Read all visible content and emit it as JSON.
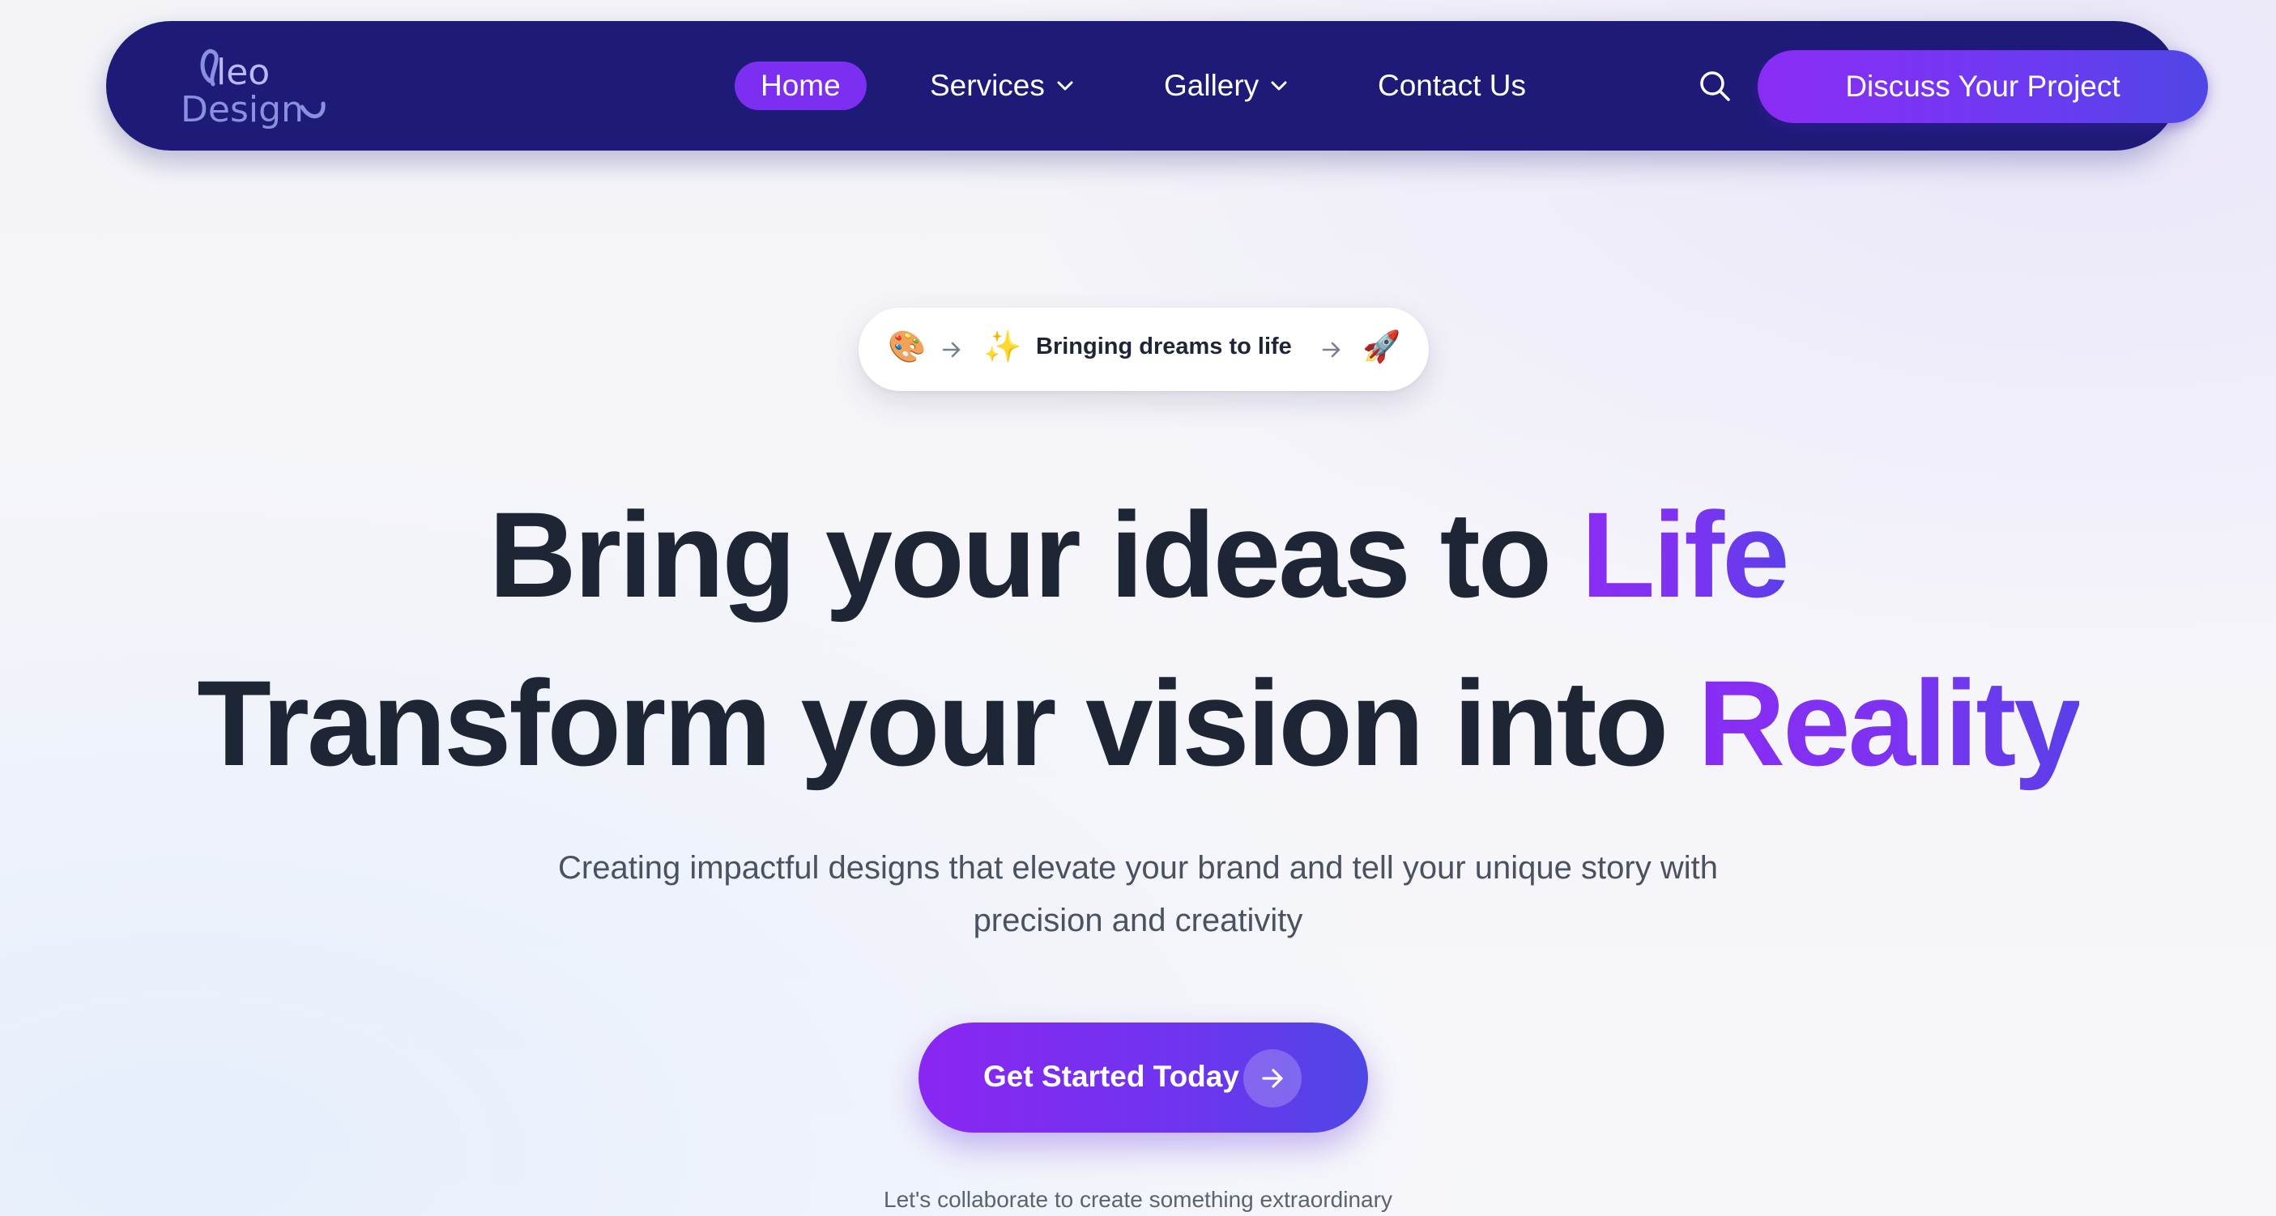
{
  "colors": {
    "nav_background": "#1e1b78",
    "accent_purple": "#7c2ff0",
    "accent_indigo": "#4f46e5",
    "heading_text": "#1e2535",
    "body_text": "#4a5160",
    "page_background": "#f5f5f9"
  },
  "nav": {
    "logo": {
      "line1": "leo",
      "line2": "Design",
      "icon": "leo-design-logo"
    },
    "links": [
      {
        "label": "Home",
        "active": true
      },
      {
        "label": "Services",
        "has_dropdown": true,
        "icon": "chevron-down-icon"
      },
      {
        "label": "Gallery",
        "has_dropdown": true,
        "icon": "chevron-down-icon"
      },
      {
        "label": "Contact Us"
      }
    ],
    "search_icon": "search-icon",
    "cta_label": "Discuss Your Project"
  },
  "hero": {
    "badge": {
      "emoji_start": "🎨",
      "emoji_sparkle": "✨",
      "emoji_end": "🚀",
      "arrow_icon": "arrow-right-icon",
      "text": "Bringing dreams to life"
    },
    "headline_line1": {
      "main": "Bring your ideas to ",
      "accent": "Life"
    },
    "headline_line2": {
      "main": "Transform your vision into ",
      "accent": "Reality"
    },
    "subtitle_line1": "Creating impactful designs that elevate your brand and tell your unique story with",
    "subtitle_line2": "precision and creativity",
    "cta_label": "Get Started Today",
    "cta_icon": "arrow-right-icon",
    "footnote": "Let's collaborate to create something extraordinary"
  }
}
